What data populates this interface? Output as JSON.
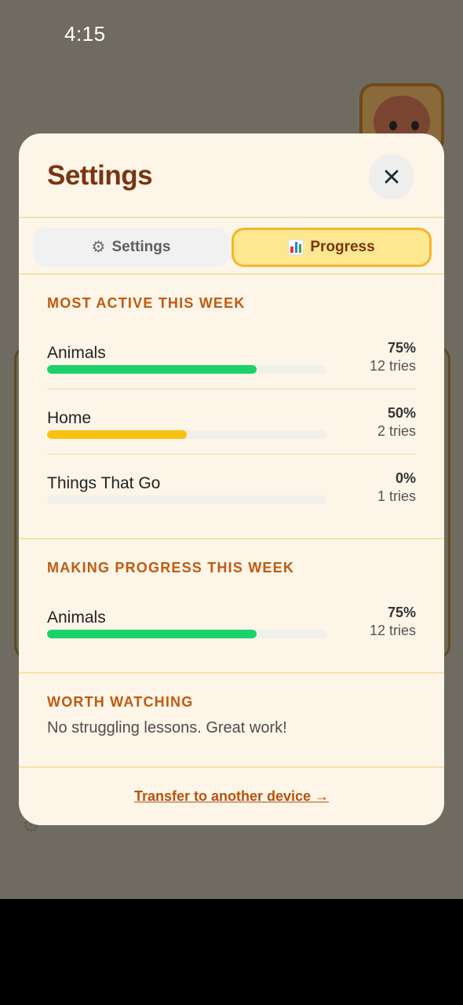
{
  "status_bar": {
    "time": "4:15"
  },
  "modal": {
    "title": "Settings",
    "close_icon": "close-icon"
  },
  "tabs": [
    {
      "label": "Settings",
      "icon": "gear-icon",
      "active": false
    },
    {
      "label": "Progress",
      "icon": "bar-chart-icon",
      "active": true
    }
  ],
  "sections": {
    "most_active": {
      "title": "MOST ACTIVE THIS WEEK",
      "items": [
        {
          "name": "Animals",
          "percent": "75%",
          "tries": "12 tries",
          "progress": 75,
          "color": "#1bd26a"
        },
        {
          "name": "Home",
          "percent": "50%",
          "tries": "2 tries",
          "progress": 50,
          "color": "#fbc111"
        },
        {
          "name": "Things That Go",
          "percent": "0%",
          "tries": "1 tries",
          "progress": 0,
          "color": "#1bd26a"
        }
      ]
    },
    "making_progress": {
      "title": "MAKING PROGRESS THIS WEEK",
      "items": [
        {
          "name": "Animals",
          "percent": "75%",
          "tries": "12 tries",
          "progress": 75,
          "color": "#1bd26a"
        }
      ]
    },
    "worth_watching": {
      "title": "WORTH WATCHING",
      "message": "No struggling lessons. Great work!"
    }
  },
  "footer": {
    "transfer_link": "Transfer to another device →"
  },
  "colors": {
    "title": "#7a3410",
    "section_title": "#c05a10",
    "modal_bg": "#fdf5e8",
    "active_tab_bg": "#fde891",
    "active_tab_border": "#f5b52a"
  }
}
